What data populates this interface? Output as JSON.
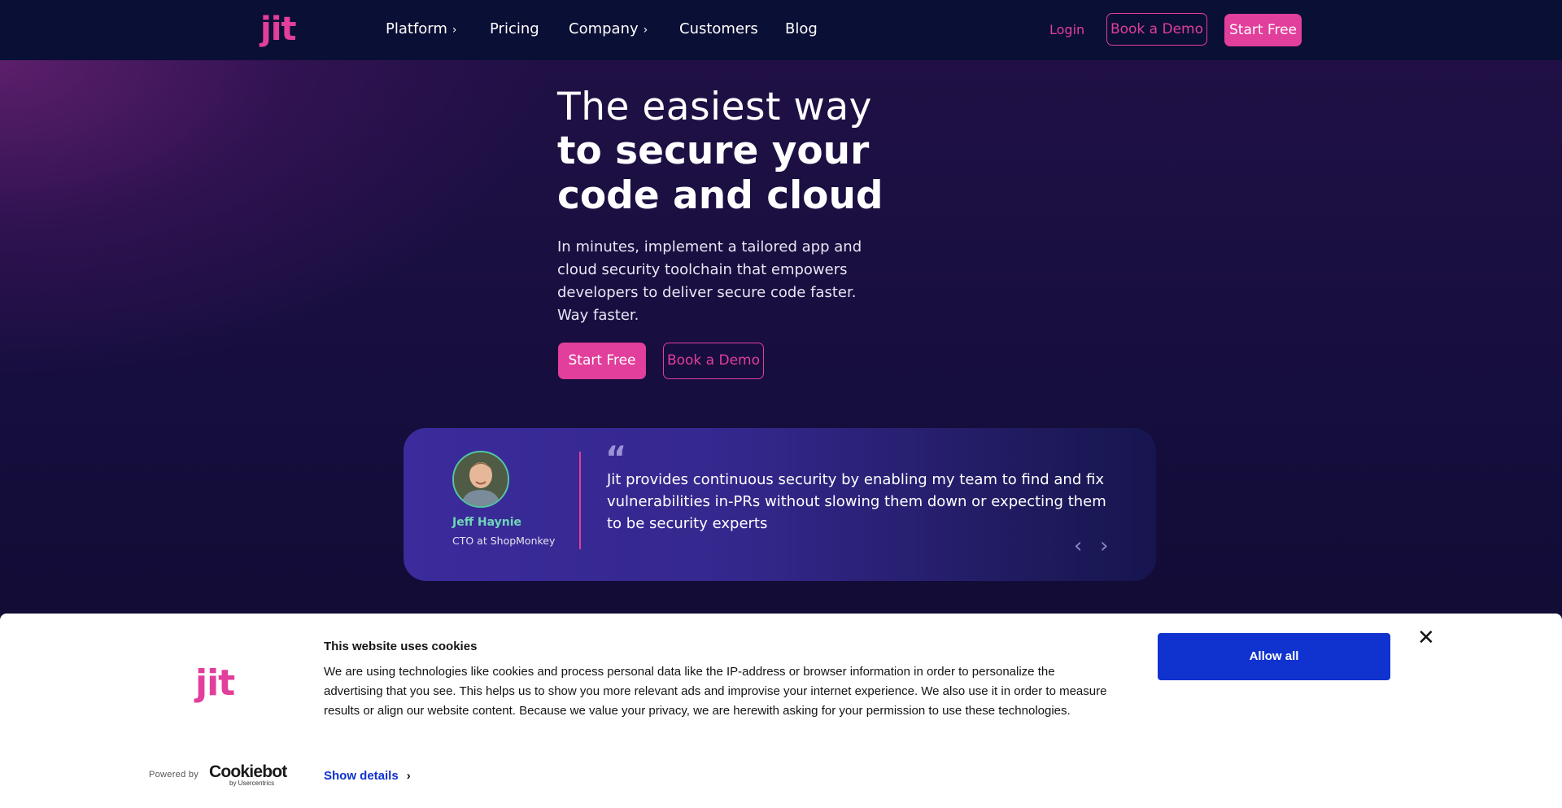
{
  "nav": {
    "logo": "jit",
    "items": [
      {
        "label": "Platform",
        "has_dropdown": true
      },
      {
        "label": "Pricing",
        "has_dropdown": false
      },
      {
        "label": "Company",
        "has_dropdown": true
      },
      {
        "label": "Customers",
        "has_dropdown": false
      },
      {
        "label": "Blog",
        "has_dropdown": false
      }
    ],
    "login": "Login",
    "book_demo": "Book a Demo",
    "start_free": "Start Free"
  },
  "hero": {
    "headline_light": "The easiest way",
    "headline_bold_1": "to secure your",
    "headline_bold_2": "code and cloud",
    "subtext": "In minutes, implement a tailored app and cloud security toolchain that empowers developers to deliver secure code faster. Way faster.",
    "primary_cta": "Start Free",
    "secondary_cta": "Book a Demo"
  },
  "testimonial": {
    "name": "Jeff Haynie",
    "role": "CTO at ShopMonkey",
    "quote": "Jit provides continuous security by enabling my team to find and fix vulnerabilities in-PRs without slowing them down or expecting them to be security experts",
    "quote_mark": "“",
    "prev_arrow": "‹",
    "next_arrow": "›"
  },
  "cookie_banner": {
    "logo": "jit",
    "title": "This website uses cookies",
    "text": "We are using technologies like cookies and process personal data like the IP-address or browser information in order to personalize the advertising that you see. This helps us to show you more relevant ads and improvise your internet experience. We also use it in order to measure results or align our website content. Because we value your privacy, we are herewith asking for your permission to use these technologies.",
    "show_details": "Show details",
    "allow_all": "Allow all",
    "powered_by": "Powered by",
    "cookiebot": "Cookiebot",
    "usercentrics": "by Usercentrics"
  },
  "colors": {
    "brand_pink": "#e23e9b",
    "nav_bg": "#0a0f35",
    "cookie_blue": "#1032cf"
  }
}
